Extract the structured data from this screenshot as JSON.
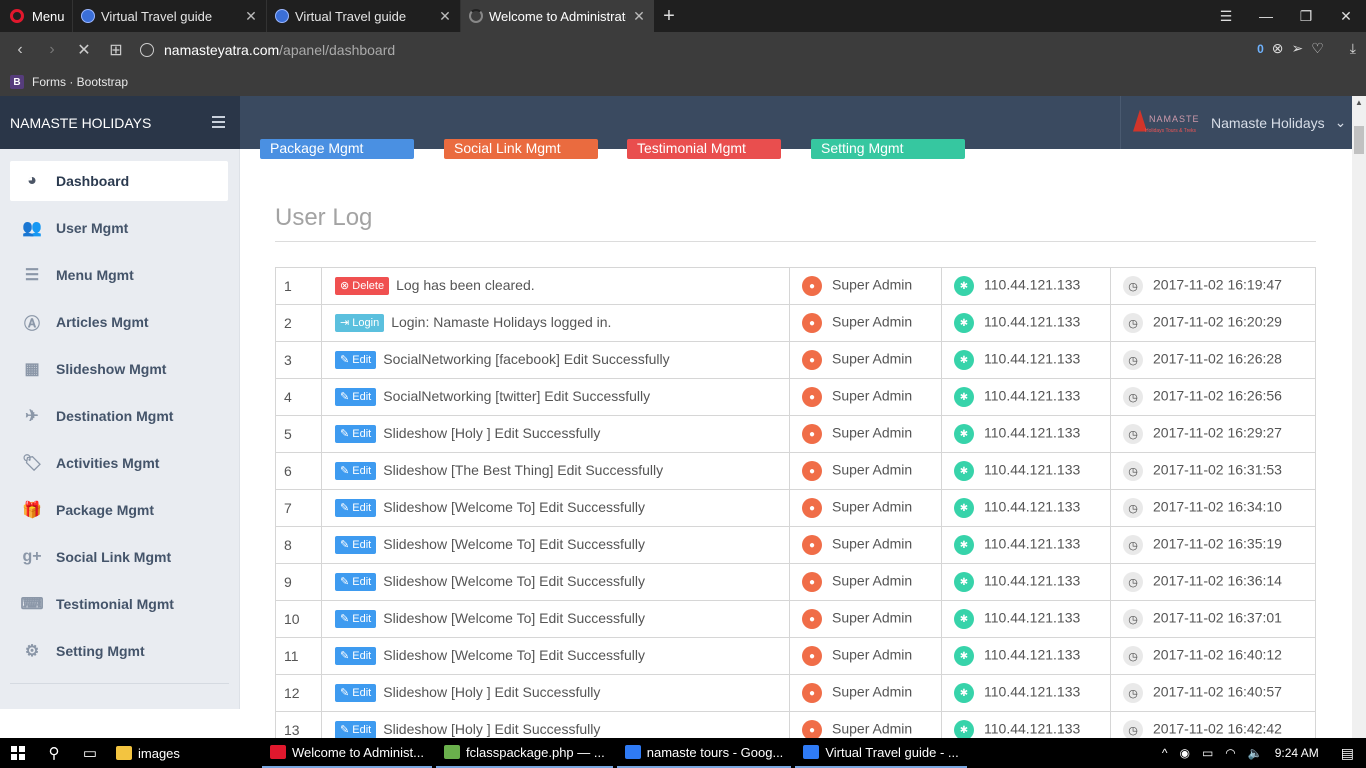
{
  "browser": {
    "menu_label": "Menu",
    "tabs": [
      {
        "title": "Virtual Travel guide",
        "active": false
      },
      {
        "title": "Virtual Travel guide",
        "active": false
      },
      {
        "title": "Welcome to Administrator",
        "active": true
      }
    ],
    "url_host": "namasteyatra.com",
    "url_path": "/apanel/dashboard",
    "adblock_count": "0",
    "bookmark": "Forms · Bootstrap"
  },
  "header": {
    "brand": "NAMASTE HOLIDAYS",
    "user_name": "Namaste Holidays",
    "logo_text": "NAMASTE",
    "logo_tagline": "Holidays Tours & Treks"
  },
  "sidebar": {
    "items": [
      {
        "label": "Dashboard",
        "icon": "dashboard-icon",
        "glyph": "◕"
      },
      {
        "label": "User Mgmt",
        "icon": "users-icon",
        "glyph": "👥"
      },
      {
        "label": "Menu Mgmt",
        "icon": "list-icon",
        "glyph": "☰"
      },
      {
        "label": "Articles Mgmt",
        "icon": "articles-icon",
        "glyph": "Ⓐ"
      },
      {
        "label": "Slideshow Mgmt",
        "icon": "film-icon",
        "glyph": "▦"
      },
      {
        "label": "Destination Mgmt",
        "icon": "plane-icon",
        "glyph": "✈"
      },
      {
        "label": "Activities Mgmt",
        "icon": "tags-icon",
        "glyph": "🏷"
      },
      {
        "label": "Package Mgmt",
        "icon": "gift-icon",
        "glyph": "🎁"
      },
      {
        "label": "Social Link Mgmt",
        "icon": "google-plus-icon",
        "glyph": "g+"
      },
      {
        "label": "Testimonial Mgmt",
        "icon": "keyboard-icon",
        "glyph": "⌨"
      },
      {
        "label": "Setting Mgmt",
        "icon": "gear-icon",
        "glyph": "⚙"
      }
    ]
  },
  "quick_links": [
    {
      "label": "Package Mgmt",
      "color": "#4a90e2"
    },
    {
      "label": "Social Link Mgmt",
      "color": "#ea6b3f"
    },
    {
      "label": "Testimonial Mgmt",
      "color": "#e94e4e"
    },
    {
      "label": "Setting Mgmt",
      "color": "#36c7a0"
    }
  ],
  "user_log": {
    "title": "User Log",
    "rows": [
      {
        "n": "1",
        "type": "Delete",
        "text": "Log has been cleared.",
        "user": "Super Admin",
        "ip": "110.44.121.133",
        "time": "2017-11-02 16:19:47"
      },
      {
        "n": "2",
        "type": "Login",
        "text": "Login: Namaste Holidays logged in.",
        "user": "Super Admin",
        "ip": "110.44.121.133",
        "time": "2017-11-02 16:20:29"
      },
      {
        "n": "3",
        "type": "Edit",
        "text": "SocialNetworking [facebook] Edit Successfully",
        "user": "Super Admin",
        "ip": "110.44.121.133",
        "time": "2017-11-02 16:26:28"
      },
      {
        "n": "4",
        "type": "Edit",
        "text": "SocialNetworking [twitter] Edit Successfully",
        "user": "Super Admin",
        "ip": "110.44.121.133",
        "time": "2017-11-02 16:26:56"
      },
      {
        "n": "5",
        "type": "Edit",
        "text": "Slideshow [Holy ] Edit Successfully",
        "user": "Super Admin",
        "ip": "110.44.121.133",
        "time": "2017-11-02 16:29:27"
      },
      {
        "n": "6",
        "type": "Edit",
        "text": "Slideshow [The Best Thing] Edit Successfully",
        "user": "Super Admin",
        "ip": "110.44.121.133",
        "time": "2017-11-02 16:31:53"
      },
      {
        "n": "7",
        "type": "Edit",
        "text": "Slideshow [Welcome To] Edit Successfully",
        "user": "Super Admin",
        "ip": "110.44.121.133",
        "time": "2017-11-02 16:34:10"
      },
      {
        "n": "8",
        "type": "Edit",
        "text": "Slideshow [Welcome To] Edit Successfully",
        "user": "Super Admin",
        "ip": "110.44.121.133",
        "time": "2017-11-02 16:35:19"
      },
      {
        "n": "9",
        "type": "Edit",
        "text": "Slideshow [Welcome To] Edit Successfully",
        "user": "Super Admin",
        "ip": "110.44.121.133",
        "time": "2017-11-02 16:36:14"
      },
      {
        "n": "10",
        "type": "Edit",
        "text": "Slideshow [Welcome To] Edit Successfully",
        "user": "Super Admin",
        "ip": "110.44.121.133",
        "time": "2017-11-02 16:37:01"
      },
      {
        "n": "11",
        "type": "Edit",
        "text": "Slideshow [Welcome To] Edit Successfully",
        "user": "Super Admin",
        "ip": "110.44.121.133",
        "time": "2017-11-02 16:40:12"
      },
      {
        "n": "12",
        "type": "Edit",
        "text": "Slideshow [Holy ] Edit Successfully",
        "user": "Super Admin",
        "ip": "110.44.121.133",
        "time": "2017-11-02 16:40:57"
      },
      {
        "n": "13",
        "type": "Edit",
        "text": "Slideshow [Holy ] Edit Successfully",
        "user": "Super Admin",
        "ip": "110.44.121.133",
        "time": "2017-11-02 16:42:42"
      }
    ]
  },
  "taskbar": {
    "apps": [
      {
        "label": "images",
        "color": "#f3c440"
      },
      {
        "label": "Welcome to Administ...",
        "color": "#e0182d"
      },
      {
        "label": "fclasspackage.php — ...",
        "color": "#6ab04c"
      },
      {
        "label": "namaste tours - Goog...",
        "color": "#2f7bf5"
      },
      {
        "label": "Virtual Travel guide - ...",
        "color": "#2f7bf5"
      }
    ],
    "time": "9:24 AM"
  }
}
